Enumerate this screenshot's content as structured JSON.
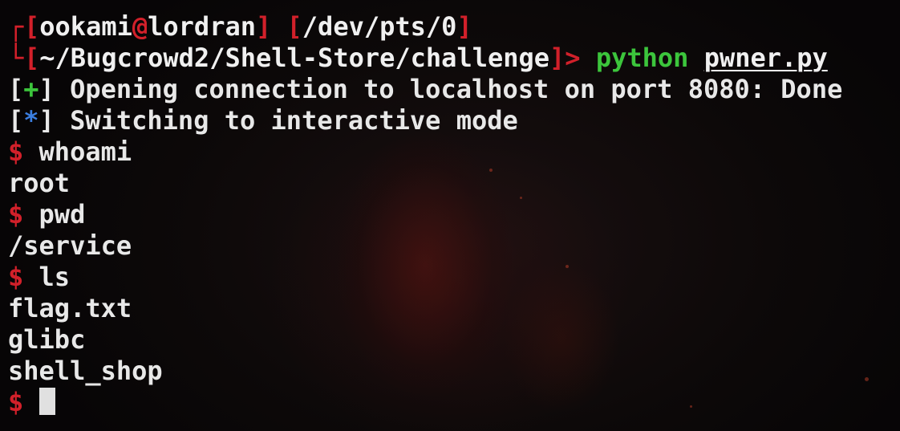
{
  "prompt": {
    "user": "ookami",
    "at": "@",
    "host": "lordran",
    "tty": "/dev/pts/0",
    "cwd": "~/Bugcrowd2/Shell-Store/challenge",
    "arrow": ">",
    "command": "python",
    "argument": "pwner.py"
  },
  "corner_top": "┌",
  "corner_bottom": "└",
  "status_lines": [
    {
      "marker": "+",
      "text": "Opening connection to localhost on port 8080: Done"
    },
    {
      "marker": "*",
      "text": "Switching to interactive mode"
    }
  ],
  "shell_symbol": "$",
  "session": [
    {
      "type": "command",
      "text": "whoami"
    },
    {
      "type": "output",
      "text": "root"
    },
    {
      "type": "command",
      "text": "pwd"
    },
    {
      "type": "output",
      "text": "/service"
    },
    {
      "type": "command",
      "text": "ls"
    },
    {
      "type": "output",
      "text": "flag.txt"
    },
    {
      "type": "output",
      "text": "glibc"
    },
    {
      "type": "output",
      "text": "shell_shop"
    }
  ],
  "colors": {
    "prompt_red": "#d2202a",
    "command_green": "#3cc53c",
    "info_blue": "#3b7ee0",
    "text": "#e8e8e8",
    "background": "#0a0708"
  }
}
